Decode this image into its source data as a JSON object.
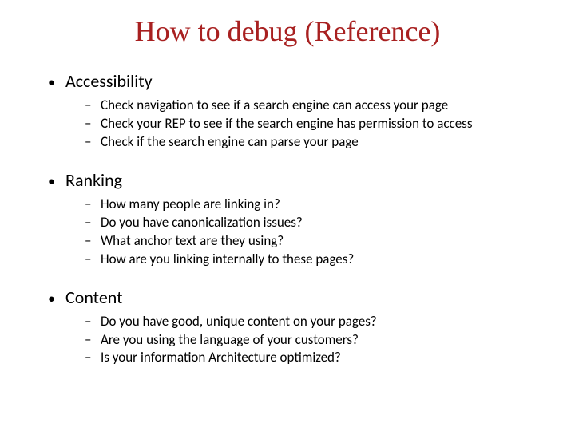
{
  "title": "How to debug (Reference)",
  "sections": [
    {
      "label": "Accessibility",
      "items": [
        "Check navigation to see if a search engine can access your page",
        "Check your REP to see if the search engine has permission to access",
        "Check if the search engine can parse your page"
      ]
    },
    {
      "label": "Ranking",
      "items": [
        "How many people are linking in?",
        "Do you have canonicalization issues?",
        "What anchor text are they using?",
        "How are you linking internally to these pages?"
      ]
    },
    {
      "label": "Content",
      "items": [
        "Do you have good, unique content on your pages?",
        "Are you using the language of your customers?",
        "Is your information Architecture optimized?"
      ]
    }
  ]
}
